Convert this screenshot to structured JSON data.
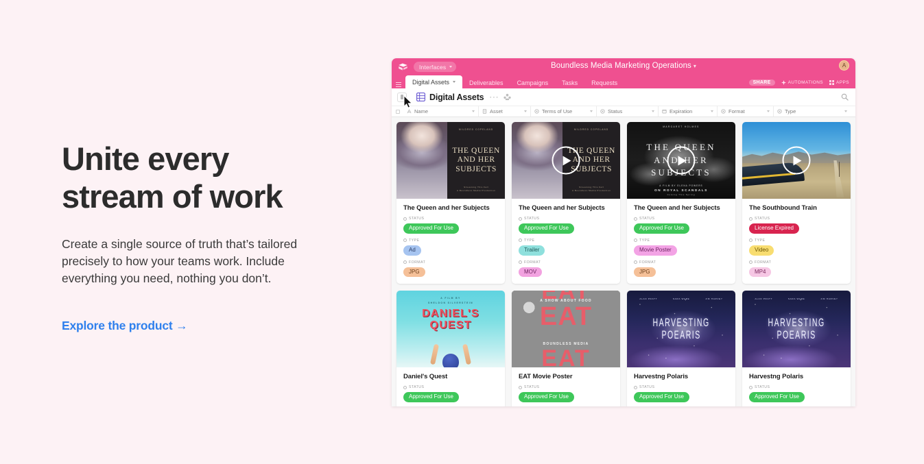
{
  "hero": {
    "heading_line1": "Unite every",
    "heading_line2": "stream of work",
    "body": "Create a single source of truth that’s tailored precisely to how your teams work. Include everything you need, nothing you don’t.",
    "cta": "Explore the product →",
    "cta_color": "#2f80ed"
  },
  "app": {
    "header": {
      "brand_icon": "airtable-logo-icon",
      "interfaces_label": "Interfaces",
      "base_title": "Boundless Media Marketing Operations",
      "base_title_caret": "▾",
      "avatar_initial": "A",
      "share_label": "SHARE",
      "automations_label": "AUTOMATIONS",
      "apps_label": "APPS",
      "accent_color": "#ef5090"
    },
    "tabs": [
      {
        "label": "Digital Assets",
        "active": true,
        "has_caret": true
      },
      {
        "label": "Deliverables",
        "active": false,
        "has_caret": false
      },
      {
        "label": "Campaigns",
        "active": false,
        "has_caret": false
      },
      {
        "label": "Tasks",
        "active": false,
        "has_caret": false
      },
      {
        "label": "Requests",
        "active": false,
        "has_caret": false
      }
    ],
    "toolbar": {
      "view_name": "Digital Assets",
      "more_label": "···",
      "panel_toggle_icon": "sidebar-toggle-icon",
      "grid_icon": "grid-view-icon",
      "collaborators_icon": "collaborators-icon",
      "search_icon": "search-icon"
    },
    "fields": [
      {
        "label": "Name",
        "icon": "text-field-icon"
      },
      {
        "label": "Asset",
        "icon": "attachment-field-icon"
      },
      {
        "label": "Terms of Use",
        "icon": "select-field-icon"
      },
      {
        "label": "Status",
        "icon": "select-field-icon"
      },
      {
        "label": "Expiration",
        "icon": "date-field-icon"
      },
      {
        "label": "Format",
        "icon": "select-field-icon"
      },
      {
        "label": "Type",
        "icon": "select-field-icon"
      }
    ],
    "card_field_labels": {
      "status": "STATUS",
      "type": "TYPE",
      "format": "FORMAT"
    },
    "cards": [
      {
        "title": "The Queen and her Subjects",
        "art": "queen-split",
        "has_play": false,
        "status": {
          "text": "Approved For Use",
          "bg": "#3ec75a",
          "fg": "#ffffff"
        },
        "type": {
          "text": "Ad",
          "bg": "#a6c4f0",
          "fg": "#2c3e66"
        },
        "format": {
          "text": "JPG",
          "bg": "#f5c098",
          "fg": "#6b3f1c"
        },
        "poster": {
          "credit": "MILDRED COPELAND",
          "title_lines": [
            "THE QUEEN",
            "AND HER",
            "SUBJECTS"
          ],
          "foot_lines": [
            "Streaming This Fall",
            "A Boundless Media Production"
          ]
        }
      },
      {
        "title": "The Queen and her Subjects",
        "art": "queen-split",
        "has_play": true,
        "status": {
          "text": "Approved For Use",
          "bg": "#3ec75a",
          "fg": "#ffffff"
        },
        "type": {
          "text": "Trailer",
          "bg": "#8fe0dd",
          "fg": "#1f5a58"
        },
        "format": {
          "text": "MOV",
          "bg": "#f2a2e0",
          "fg": "#6d2461"
        },
        "poster": {
          "credit": "MILDRED COPELAND",
          "title_lines": [
            "THE QUEEN",
            "AND HER",
            "SUBJECTS"
          ],
          "foot_lines": [
            "Streaming This Fall",
            "A Boundless Media Production"
          ]
        }
      },
      {
        "title": "The Queen and her Subjects",
        "art": "queen-bw",
        "has_play": true,
        "status": {
          "text": "Approved For Use",
          "bg": "#3ec75a",
          "fg": "#ffffff"
        },
        "type": {
          "text": "Movie Poster",
          "bg": "#f3a3e5",
          "fg": "#6d2461"
        },
        "format": {
          "text": "JPG",
          "bg": "#f5c098",
          "fg": "#6b3f1c"
        },
        "poster": {
          "credit": "MARGARET HOLMES",
          "title_lines": [
            "THE QUEEN",
            "AND HER",
            "SUBJECTS"
          ],
          "foot_a": "A FILM BY ELENA POWERS",
          "foot_b": "ON ROYAL SCANDALS",
          "foot_c": "Coming This Spring"
        }
      },
      {
        "title": "The Southbound Train",
        "art": "train",
        "has_play": true,
        "status": {
          "text": "License Expired",
          "bg": "#d8244f",
          "fg": "#ffffff"
        },
        "type": {
          "text": "Video",
          "bg": "#f8dd71",
          "fg": "#6b5500"
        },
        "format": {
          "text": "MP4",
          "bg": "#f6c7e4",
          "fg": "#7a2a5e"
        },
        "poster": {}
      },
      {
        "title": "Daniel's Quest",
        "art": "daniel",
        "has_play": false,
        "status": {
          "text": "Approved For Use",
          "bg": "#3ec75a",
          "fg": "#ffffff"
        },
        "poster": {
          "credit_line1": "A FILM BY",
          "credit_line2": "SHELDON SILVERSTEIN",
          "title_lines": [
            "DANIEL'S",
            "QUEST"
          ]
        }
      },
      {
        "title": "EAT Movie Poster",
        "art": "eat",
        "has_play": false,
        "status": {
          "text": "Approved For Use",
          "bg": "#3ec75a",
          "fg": "#ffffff"
        },
        "poster": {
          "tagline_top": "A SHOW ABOUT FOOD",
          "big_word": "EAT",
          "tagline_bottom": "BOUNDLESS MEDIA"
        }
      },
      {
        "title": "Harvestng Polaris",
        "art": "polaris",
        "has_play": false,
        "status": {
          "text": "Approved For Use",
          "bg": "#3ec75a",
          "fg": "#ffffff"
        },
        "poster": {
          "credits": [
            "ALAN PRATT",
            "SARA WARE",
            "JIM HARVEY"
          ],
          "title_lines": [
            "HARVESTING",
            "POEARIS"
          ]
        }
      },
      {
        "title": "Harvestng Polaris",
        "art": "polaris",
        "has_play": false,
        "status": {
          "text": "Approved For Use",
          "bg": "#3ec75a",
          "fg": "#ffffff"
        },
        "poster": {
          "credits": [
            "ALAN PRATT",
            "SARA WARE",
            "JIM HARVEY"
          ],
          "title_lines": [
            "HARVESTING",
            "POEARIS"
          ]
        }
      }
    ]
  }
}
